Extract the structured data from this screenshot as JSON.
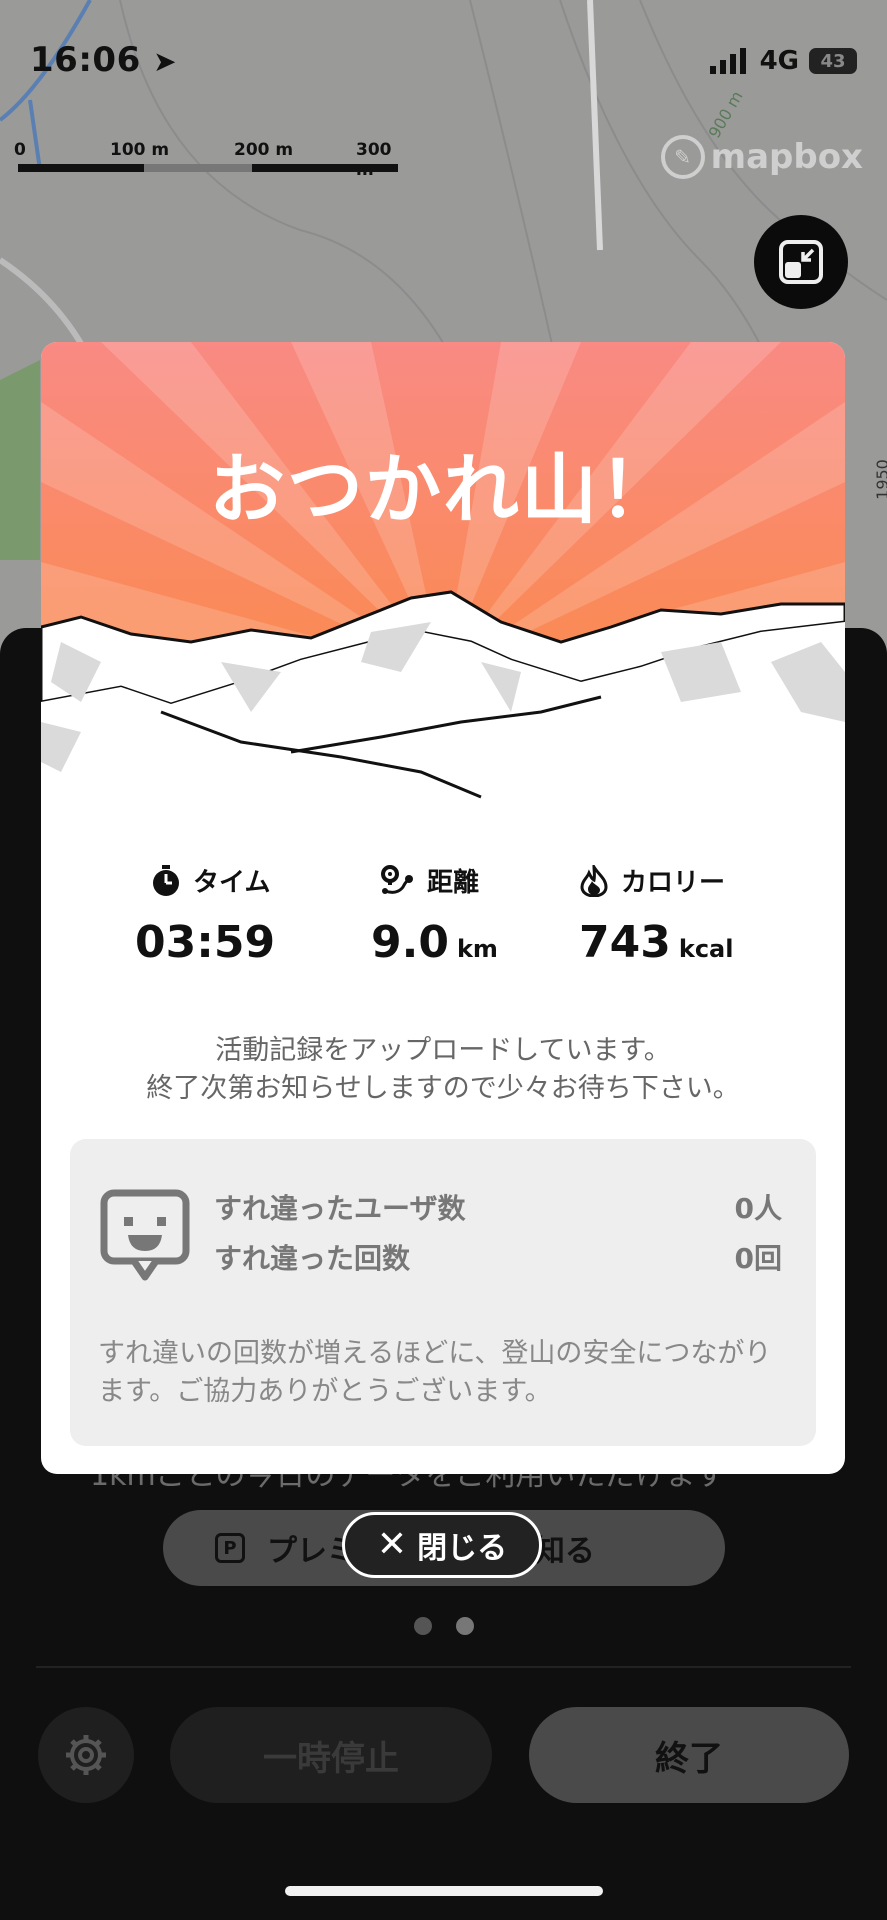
{
  "status_bar": {
    "time": "16:06",
    "network": "4G",
    "battery": "43"
  },
  "map": {
    "scale_labels": [
      "0",
      "100 m",
      "200 m",
      "300 m"
    ],
    "contour_labels": [
      "900 m",
      "1950"
    ],
    "attribution": "mapbox"
  },
  "modal": {
    "title": "おつかれ山！",
    "stats": [
      {
        "icon": "stopwatch-icon",
        "label": "タイム",
        "value": "03:59",
        "unit": ""
      },
      {
        "icon": "route-icon",
        "label": "距離",
        "value": "9.0",
        "unit": "km"
      },
      {
        "icon": "flame-icon",
        "label": "カロリー",
        "value": "743",
        "unit": "kcal"
      }
    ],
    "upload_message_line1": "活動記録をアップロードしています。",
    "upload_message_line2": "終了次第お知らせしますので少々お待ち下さい。",
    "encounter": {
      "users_label": "すれ違ったユーザ数",
      "users_value": "0人",
      "count_label": "すれ違った回数",
      "count_value": "0回",
      "note": "すれ違いの回数が増えるほどに、登山の安全につながります。ご協力ありがとうございます。"
    }
  },
  "panel": {
    "partial_text": "1kmごとの今日のデータをご利用いただけます",
    "premium_button_label": "プレミアムを詳しく知る",
    "close_button_label": "閉じる",
    "pause_button_label": "一時停止",
    "end_button_label": "終了"
  },
  "colors": {
    "hero_top": "#f98a84",
    "hero_bottom": "#fb8a3a",
    "panel_bg": "#0f0f0f",
    "modal_bg": "#ffffff"
  }
}
